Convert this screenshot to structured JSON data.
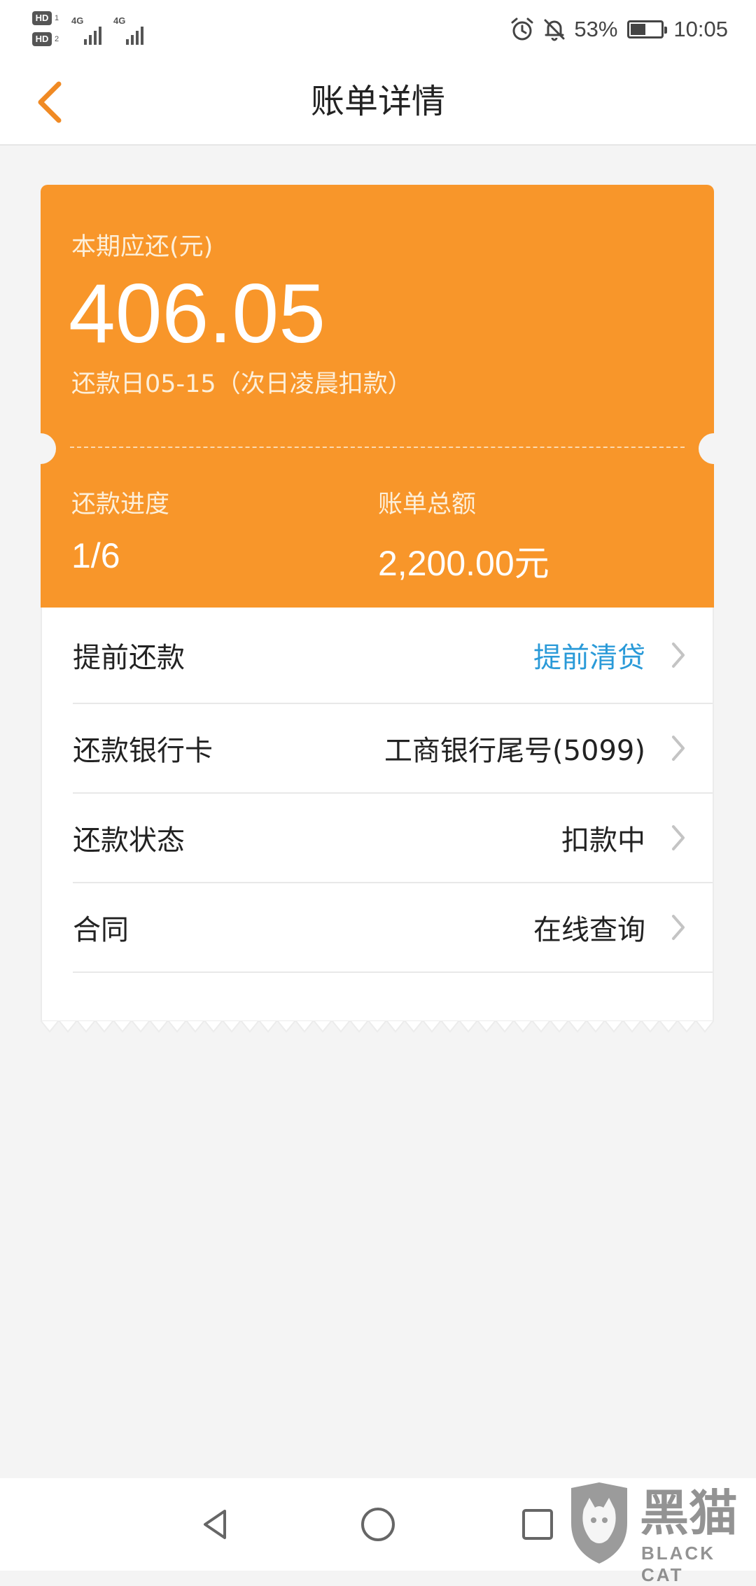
{
  "status_bar": {
    "hd1_label": "HD",
    "hd1_sub": "1",
    "hd2_label": "HD",
    "hd2_sub": "2",
    "network1": "4G",
    "network2": "4G",
    "alarm_icon": "alarm-icon",
    "mute_icon": "bell-off-icon",
    "battery_percent": "53%",
    "battery_level": 0.53,
    "time": "10:05"
  },
  "header": {
    "back_icon": "chevron-left-icon",
    "title": "账单详情"
  },
  "bill": {
    "due_label": "本期应还(元)",
    "due_amount": "406.05",
    "due_date": "还款日05-15（次日凌晨扣款）",
    "progress_label": "还款进度",
    "progress_value": "1/6",
    "total_label": "账单总额",
    "total_value": "2,200.00元"
  },
  "rows": [
    {
      "label": "提前还款",
      "value": "提前清贷"
    },
    {
      "label": "还款银行卡",
      "value": "工商银行尾号(5099)"
    },
    {
      "label": "还款状态",
      "value": "扣款中"
    },
    {
      "label": "合同",
      "value": "在线查询"
    }
  ],
  "nav": {
    "back_icon": "triangle-back-icon",
    "home_icon": "circle-home-icon",
    "recent_icon": "square-recent-icon"
  },
  "watermark": {
    "text_cn": "黑猫",
    "text_en": "BLACK CAT"
  },
  "colors": {
    "accent_orange": "#f8962a",
    "link_blue": "#2a9ad8",
    "background": "#f4f4f4"
  }
}
